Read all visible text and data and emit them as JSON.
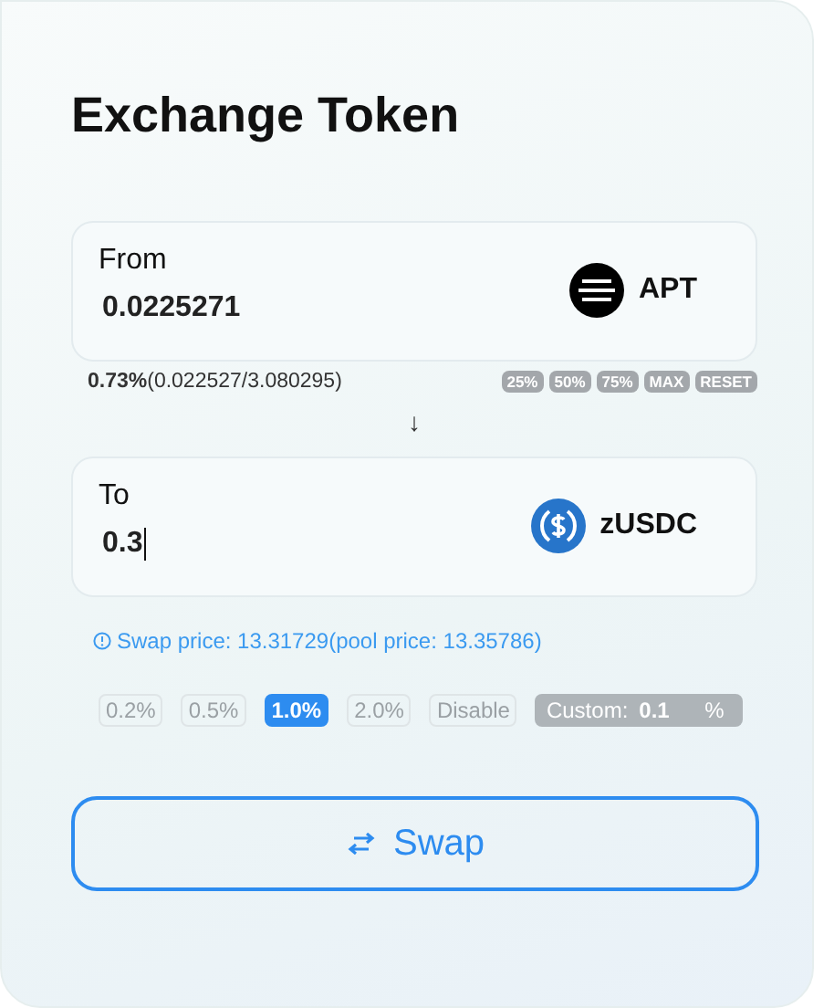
{
  "title": "Exchange Token",
  "from": {
    "label": "From",
    "amount": "0.0225271",
    "token": "APT"
  },
  "balance": {
    "percent": "0.73%",
    "detail": "(0.022527/3.080295)"
  },
  "quick_amounts": [
    "25%",
    "50%",
    "75%",
    "MAX",
    "RESET"
  ],
  "direction_arrow": "↓",
  "to": {
    "label": "To",
    "amount": "0.3",
    "token": "zUSDC",
    "focused": true
  },
  "price_info": "Swap price: 13.31729(pool price: 13.35786)",
  "slippage": [
    {
      "label": "0.2%",
      "selected": false
    },
    {
      "label": "0.5%",
      "selected": false
    },
    {
      "label": "1.0%",
      "selected": true
    },
    {
      "label": "2.0%",
      "selected": false
    },
    {
      "label": "Disable",
      "selected": false
    }
  ],
  "custom_slippage": {
    "label": "Custom:",
    "value": "0.1",
    "unit": "%",
    "disabled": true
  },
  "swap_button": "Swap"
}
